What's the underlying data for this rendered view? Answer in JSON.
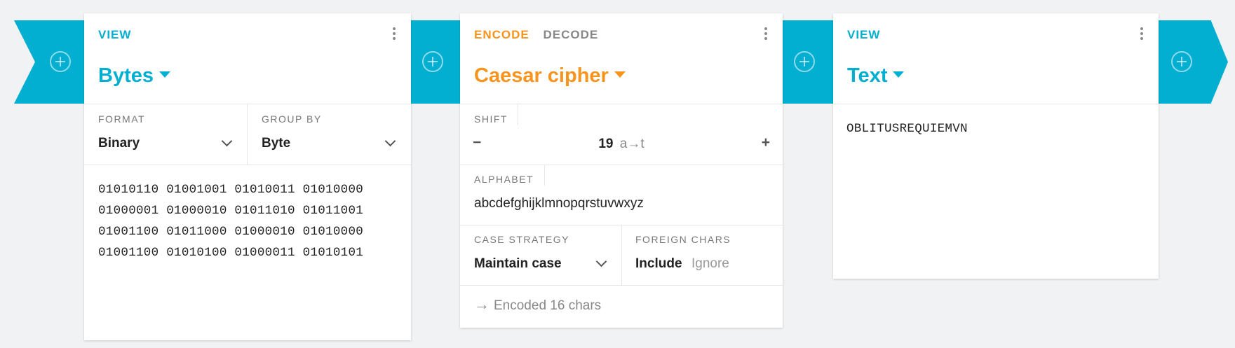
{
  "colors": {
    "accent_blue": "#03afd1",
    "accent_orange": "#f7941d"
  },
  "pipeline": {
    "add_icon": "plus-circle-icon"
  },
  "bytes_card": {
    "tab": "VIEW",
    "title": "Bytes",
    "format_label": "FORMAT",
    "format_value": "Binary",
    "group_label": "GROUP BY",
    "group_value": "Byte",
    "content": "01010110 01001001 01010011 01010000\n01000001 01000010 01011010 01011001\n01001100 01011000 01000010 01010000\n01001100 01010100 01000011 01010101"
  },
  "cipher_card": {
    "tab_encode": "ENCODE",
    "tab_decode": "DECODE",
    "title": "Caesar cipher",
    "shift_label": "SHIFT",
    "shift_minus": "−",
    "shift_value": "19",
    "shift_hint": "a→t",
    "shift_plus": "+",
    "alphabet_label": "ALPHABET",
    "alphabet_value": "abcdefghijklmnopqrstuvwxyz",
    "case_label": "CASE STRATEGY",
    "case_value": "Maintain case",
    "foreign_label": "FOREIGN CHARS",
    "foreign_include": "Include",
    "foreign_ignore": "Ignore",
    "status": "Encoded 16 chars"
  },
  "text_card": {
    "tab": "VIEW",
    "title": "Text",
    "content": "OBLITUSREQUIEMVN"
  }
}
